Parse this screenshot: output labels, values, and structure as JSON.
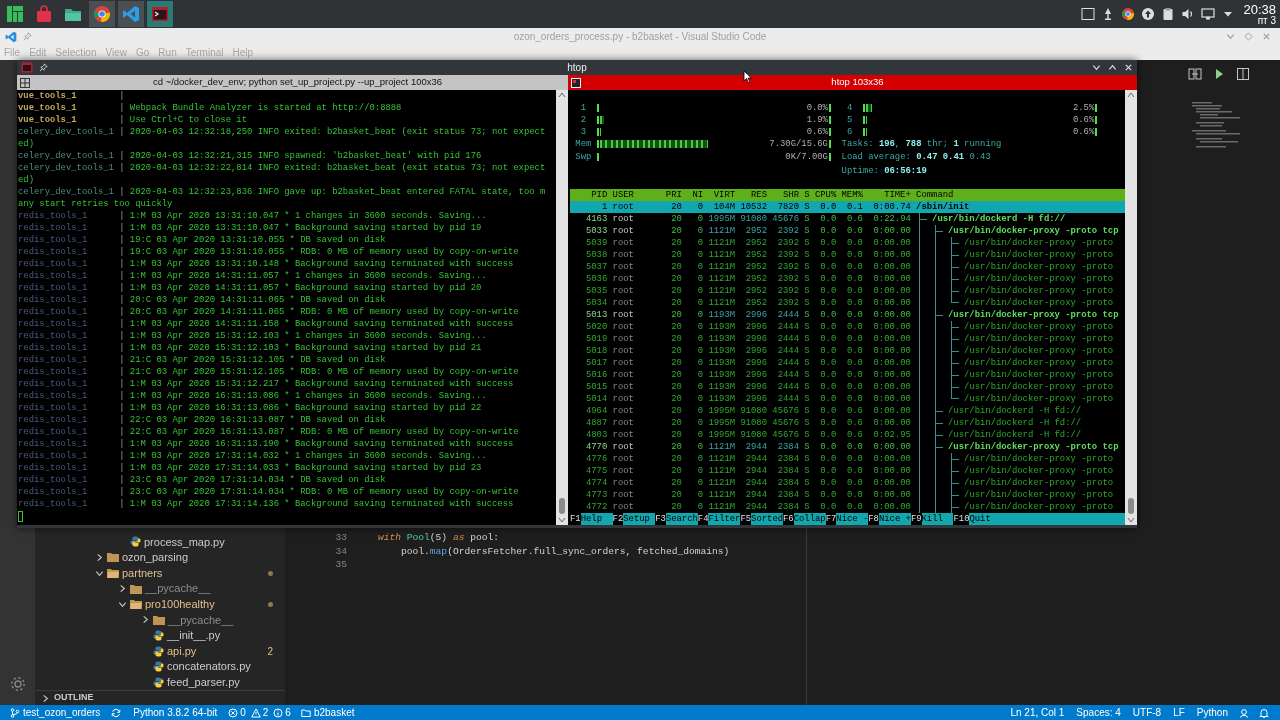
{
  "panel": {
    "tasks": [
      {
        "kind": "settings",
        "running": false,
        "selected": false
      },
      {
        "kind": "store",
        "running": false,
        "selected": false
      },
      {
        "kind": "files",
        "running": false,
        "selected": false
      },
      {
        "kind": "chrome",
        "running": true,
        "selected": false
      },
      {
        "kind": "vscode",
        "running": true,
        "selected": false
      },
      {
        "kind": "terminal",
        "running": true,
        "selected": true
      }
    ],
    "clock": {
      "time": "20:38",
      "day": "пт 3"
    }
  },
  "vscode": {
    "title": "ozon_orders_process.py - b2basket - Visual Studio Code",
    "menu": [
      "File",
      "Edit",
      "Selection",
      "View",
      "Go",
      "Run",
      "Terminal",
      "Help"
    ],
    "explorer": {
      "continued_files": [
        {
          "name": "process_map.py",
          "kind": "python",
          "modified": false,
          "ignored": false
        }
      ],
      "items": [
        {
          "name": "ozon_parsing",
          "kind": "folder",
          "modified": false,
          "ignored": false,
          "expanded": false
        },
        {
          "name": "partners",
          "kind": "folder",
          "modified": true,
          "ignored": false,
          "expanded": true,
          "children": [
            {
              "name": "__pycache__",
              "kind": "folder",
              "modified": false,
              "ignored": true,
              "expanded": false
            },
            {
              "name": "pro100healthy",
              "kind": "folder",
              "modified": true,
              "ignored": false,
              "expanded": true,
              "children": [
                {
                  "name": "__pycache__",
                  "kind": "folder",
                  "modified": false,
                  "ignored": true,
                  "expanded": false
                },
                {
                  "name": "__init__.py",
                  "kind": "python",
                  "modified": false,
                  "ignored": false
                },
                {
                  "name": "api.py",
                  "kind": "python",
                  "modified": true,
                  "ignored": false,
                  "problems": "2"
                },
                {
                  "name": "concatenators.py",
                  "kind": "python",
                  "modified": false,
                  "ignored": false
                },
                {
                  "name": "feed_parser.py",
                  "kind": "python",
                  "modified": false,
                  "ignored": false
                }
              ]
            }
          ]
        }
      ],
      "outline": {
        "label": "OUTLINE",
        "expanded": false
      }
    },
    "editor": {
      "lines": [
        {
          "number": "33",
          "tokens": [
            {
              "kind": "keyword",
              "text": "with"
            },
            {
              "kind": "class",
              "text": " Pool"
            },
            {
              "kind": "plain",
              "text": "(5) "
            },
            {
              "kind": "keyword",
              "text": "as"
            },
            {
              "kind": "plain",
              "text": " pool:"
            }
          ],
          "children": [
            {
              "number": "34",
              "tokens": [
                {
                  "kind": "plain",
                  "text": "pool."
                },
                {
                  "kind": "function",
                  "text": "map"
                },
                {
                  "kind": "plain",
                  "text": "(OrdersFetcher.full_sync_orders, fetched_domains)"
                }
              ]
            }
          ]
        },
        {
          "number": "35"
        }
      ]
    },
    "status_bar": {
      "left": [
        {
          "kind": "branch",
          "text": "test_ozon_orders"
        },
        {
          "kind": "sync"
        },
        {
          "kind": "interpreter",
          "text": "Python 3.8.2 64-bit"
        },
        {
          "kind": "problems",
          "errors": "0",
          "warnings": "2",
          "infos": "6"
        },
        {
          "kind": "folder",
          "text": "b2basket"
        }
      ],
      "right": [
        {
          "kind": "text",
          "text": "Ln 21, Col 1"
        },
        {
          "kind": "text",
          "text": "Spaces: 4"
        },
        {
          "kind": "text",
          "text": "UTF-8"
        },
        {
          "kind": "text",
          "text": "LF"
        },
        {
          "kind": "text",
          "text": "Python"
        },
        {
          "kind": "feedback"
        },
        {
          "kind": "bell"
        }
      ]
    }
  },
  "terminal": {
    "title": "htop",
    "left_pane": {
      "title": "cd ~/docker_dev_env; python set_up_project.py --up_project 100x36",
      "selected": false,
      "lines": [
        {
          "kind": "vue",
          "source": "vue_tools_1",
          "separator": "|"
        },
        {
          "kind": "vue",
          "source": "vue_tools_1",
          "separator": "|",
          "message": "Webpack Bundle Analyzer is started at http://0:8888"
        },
        {
          "kind": "vue",
          "source": "vue_tools_1",
          "separator": "|",
          "message": "Use Ctrl+C to close it"
        },
        {
          "kind": "celery",
          "source": "celery_dev_tools_1",
          "separator": "|",
          "message": "2020-04-03 12:32:18,250 INFO exited: b2basket_beat (exit status 73; not expect"
        },
        {
          "kind": "wrap",
          "message": "ed)"
        },
        {
          "kind": "celery",
          "source": "celery_dev_tools_1",
          "separator": "|",
          "message": "2020-04-03 12:32:21,315 INFO spawned: 'b2basket_beat' with pid 176"
        },
        {
          "kind": "celery",
          "source": "celery_dev_tools_1",
          "separator": "|",
          "message": "2020-04-03 12:32:22,814 INFO exited: b2basket_beat (exit status 73; not expect"
        },
        {
          "kind": "wrap",
          "message": "ed)"
        },
        {
          "kind": "celery",
          "source": "celery_dev_tools_1",
          "separator": "|",
          "message": "2020-04-03 12:32:23,836 INFO gave up: b2basket_beat entered FATAL state, too m"
        },
        {
          "kind": "wrap",
          "message": "any start retries too quickly"
        },
        {
          "kind": "redis",
          "source": "redis_tools_1",
          "separator": "|",
          "message": "1:M 03 Apr 2020 13:31:10.047 * 1 changes in 3600 seconds. Saving..."
        },
        {
          "kind": "redis",
          "source": "redis_tools_1",
          "separator": "|",
          "message": "1:M 03 Apr 2020 13:31:10.047 * Background saving started by pid 19"
        },
        {
          "kind": "redis",
          "source": "redis_tools_1",
          "separator": "|",
          "message": "19:C 03 Apr 2020 13:31:10.055 * DB saved on disk"
        },
        {
          "kind": "redis",
          "source": "redis_tools_1",
          "separator": "|",
          "message": "19:C 03 Apr 2020 13:31:10.055 * RDB: 0 MB of memory used by copy-on-write"
        },
        {
          "kind": "redis",
          "source": "redis_tools_1",
          "separator": "|",
          "message": "1:M 03 Apr 2020 13:31:10.148 * Background saving terminated with success"
        },
        {
          "kind": "redis",
          "source": "redis_tools_1",
          "separator": "|",
          "message": "1:M 03 Apr 2020 14:31:11.057 * 1 changes in 3600 seconds. Saving..."
        },
        {
          "kind": "redis",
          "source": "redis_tools_1",
          "separator": "|",
          "message": "1:M 03 Apr 2020 14:31:11.057 * Background saving started by pid 20"
        },
        {
          "kind": "redis",
          "source": "redis_tools_1",
          "separator": "|",
          "message": "20:C 03 Apr 2020 14:31:11.065 * DB saved on disk"
        },
        {
          "kind": "redis",
          "source": "redis_tools_1",
          "separator": "|",
          "message": "20:C 03 Apr 2020 14:31:11.065 * RDB: 0 MB of memory used by copy-on-write"
        },
        {
          "kind": "redis",
          "source": "redis_tools_1",
          "separator": "|",
          "message": "1:M 03 Apr 2020 14:31:11.158 * Background saving terminated with success"
        },
        {
          "kind": "redis",
          "source": "redis_tools_1",
          "separator": "|",
          "message": "1:M 03 Apr 2020 15:31:12.103 * 1 changes in 3600 seconds. Saving..."
        },
        {
          "kind": "redis",
          "source": "redis_tools_1",
          "separator": "|",
          "message": "1:M 03 Apr 2020 15:31:12.103 * Background saving started by pid 21"
        },
        {
          "kind": "redis",
          "source": "redis_tools_1",
          "separator": "|",
          "message": "21:C 03 Apr 2020 15:31:12.105 * DB saved on disk"
        },
        {
          "kind": "redis",
          "source": "redis_tools_1",
          "separator": "|",
          "message": "21:C 03 Apr 2020 15:31:12.105 * RDB: 0 MB of memory used by copy-on-write"
        },
        {
          "kind": "redis",
          "source": "redis_tools_1",
          "separator": "|",
          "message": "1:M 03 Apr 2020 15:31:12.217 * Background saving terminated with success"
        },
        {
          "kind": "redis",
          "source": "redis_tools_1",
          "separator": "|",
          "message": "1:M 03 Apr 2020 16:31:13.086 * 1 changes in 3600 seconds. Saving..."
        },
        {
          "kind": "redis",
          "source": "redis_tools_1",
          "separator": "|",
          "message": "1:M 03 Apr 2020 16:31:13.086 * Background saving started by pid 22"
        },
        {
          "kind": "redis",
          "source": "redis_tools_1",
          "separator": "|",
          "message": "22:C 03 Apr 2020 16:31:13.087 * DB saved on disk"
        },
        {
          "kind": "redis",
          "source": "redis_tools_1",
          "separator": "|",
          "message": "22:C 03 Apr 2020 16:31:13.087 * RDB: 0 MB of memory used by copy-on-write"
        },
        {
          "kind": "redis",
          "source": "redis_tools_1",
          "separator": "|",
          "message": "1:M 03 Apr 2020 16:31:13.190 * Background saving terminated with success"
        },
        {
          "kind": "redis",
          "source": "redis_tools_1",
          "separator": "|",
          "message": "1:M 03 Apr 2020 17:31:14.032 * 1 changes in 3600 seconds. Saving..."
        },
        {
          "kind": "redis",
          "source": "redis_tools_1",
          "separator": "|",
          "message": "1:M 03 Apr 2020 17:31:14.033 * Background saving started by pid 23"
        },
        {
          "kind": "redis",
          "source": "redis_tools_1",
          "separator": "|",
          "message": "23:C 03 Apr 2020 17:31:14.034 * DB saved on disk"
        },
        {
          "kind": "redis",
          "source": "redis_tools_1",
          "separator": "|",
          "message": "23:C 03 Apr 2020 17:31:14.034 * RDB: 0 MB of memory used by copy-on-write"
        },
        {
          "kind": "redis",
          "source": "redis_tools_1",
          "separator": "|",
          "message": "1:M 03 Apr 2020 17:31:14.136 * Background saving terminated with success"
        }
      ]
    },
    "right_pane": {
      "title": "htop 103x36",
      "selected": true,
      "htop": {
        "cpus": [
          {
            "label": "1",
            "level": 0,
            "reading": "0.0%"
          },
          {
            "label": "2",
            "level": 0.019,
            "reading": "1.9%"
          },
          {
            "label": "3",
            "level": 0.006,
            "reading": "0.6%"
          },
          {
            "label": "4",
            "level": 0.025,
            "reading": "2.5%"
          },
          {
            "label": "5",
            "level": 0.006,
            "reading": "0.6%"
          },
          {
            "label": "6",
            "level": 0.006,
            "reading": "0.6%"
          }
        ],
        "memory": {
          "label": "Mem",
          "level": 0.47,
          "reading": "7.30G/15.6G"
        },
        "swap": {
          "label": "Swp",
          "level": 0,
          "reading": "0K/7.00G"
        },
        "tasks": "Tasks: **196**, **788** thr; **1** running",
        "load": "Load average: **0.47** **0.41** 0.43",
        "uptime": "Uptime: **06:56:19**",
        "columns": [
          "PID",
          "USER",
          "PRI",
          "NI",
          "VIRT",
          "RES",
          "SHR",
          "S",
          "CPU%",
          "MEM%",
          "TIME+",
          "Command"
        ],
        "tree_continues": true,
        "processes": [
          {
            "pid": "1",
            "user": "root",
            "pri": "20",
            "ni": "0",
            "virt": "104M",
            "res": "10532",
            "shr": "7820",
            "s": "S",
            "cpu": "0.0",
            "mem": "0.1",
            "time": "0:00.74",
            "command": "/sbin/init",
            "kind": "process",
            "selected": true,
            "children": [
              {
                "pid": "4163",
                "user": "root",
                "pri": "20",
                "ni": "0",
                "virt": "1995M",
                "res": "91080",
                "shr": "45676",
                "s": "S",
                "cpu": "0.0",
                "mem": "0.6",
                "time": "0:22.94",
                "command": "/usr/bin/dockerd -H fd://",
                "kind": "process",
                "selected": false,
                "children": [
                  {
                    "pid": "5033",
                    "user": "root",
                    "pri": "20",
                    "ni": "0",
                    "virt": "1121M",
                    "res": "2952",
                    "shr": "2392",
                    "s": "S",
                    "cpu": "0.0",
                    "mem": "0.0",
                    "time": "0:00.00",
                    "command": "/usr/bin/docker-proxy -proto tcp",
                    "kind": "process",
                    "selected": false,
                    "children": [
                      {
                        "pid": "5039",
                        "user": "root",
                        "pri": "20",
                        "ni": "0",
                        "virt": "1121M",
                        "res": "2952",
                        "shr": "2392",
                        "s": "S",
                        "cpu": "0.0",
                        "mem": "0.0",
                        "time": "0:00.00",
                        "command": "/usr/bin/docker-proxy -proto",
                        "kind": "thread",
                        "selected": false
                      },
                      {
                        "pid": "5038",
                        "user": "root",
                        "pri": "20",
                        "ni": "0",
                        "virt": "1121M",
                        "res": "2952",
                        "shr": "2392",
                        "s": "S",
                        "cpu": "0.0",
                        "mem": "0.0",
                        "time": "0:00.00",
                        "command": "/usr/bin/docker-proxy -proto",
                        "kind": "thread",
                        "selected": false
                      },
                      {
                        "pid": "5037",
                        "user": "root",
                        "pri": "20",
                        "ni": "0",
                        "virt": "1121M",
                        "res": "2952",
                        "shr": "2392",
                        "s": "S",
                        "cpu": "0.0",
                        "mem": "0.0",
                        "time": "0:00.00",
                        "command": "/usr/bin/docker-proxy -proto",
                        "kind": "thread",
                        "selected": false
                      },
                      {
                        "pid": "5036",
                        "user": "root",
                        "pri": "20",
                        "ni": "0",
                        "virt": "1121M",
                        "res": "2952",
                        "shr": "2392",
                        "s": "S",
                        "cpu": "0.0",
                        "mem": "0.0",
                        "time": "0:00.00",
                        "command": "/usr/bin/docker-proxy -proto",
                        "kind": "thread",
                        "selected": false
                      },
                      {
                        "pid": "5035",
                        "user": "root",
                        "pri": "20",
                        "ni": "0",
                        "virt": "1121M",
                        "res": "2952",
                        "shr": "2392",
                        "s": "S",
                        "cpu": "0.0",
                        "mem": "0.0",
                        "time": "0:00.00",
                        "command": "/usr/bin/docker-proxy -proto",
                        "kind": "thread",
                        "selected": false
                      },
                      {
                        "pid": "5034",
                        "user": "root",
                        "pri": "20",
                        "ni": "0",
                        "virt": "1121M",
                        "res": "2952",
                        "shr": "2392",
                        "s": "S",
                        "cpu": "0.0",
                        "mem": "0.0",
                        "time": "0:00.00",
                        "command": "/usr/bin/docker-proxy -proto",
                        "kind": "thread",
                        "selected": false
                      }
                    ]
                  },
                  {
                    "pid": "5013",
                    "user": "root",
                    "pri": "20",
                    "ni": "0",
                    "virt": "1193M",
                    "res": "2996",
                    "shr": "2444",
                    "s": "S",
                    "cpu": "0.0",
                    "mem": "0.0",
                    "time": "0:00.00",
                    "command": "/usr/bin/docker-proxy -proto tcp",
                    "kind": "process",
                    "selected": false,
                    "children": [
                      {
                        "pid": "5020",
                        "user": "root",
                        "pri": "20",
                        "ni": "0",
                        "virt": "1193M",
                        "res": "2996",
                        "shr": "2444",
                        "s": "S",
                        "cpu": "0.0",
                        "mem": "0.0",
                        "time": "0:00.00",
                        "command": "/usr/bin/docker-proxy -proto",
                        "kind": "thread",
                        "selected": false
                      },
                      {
                        "pid": "5019",
                        "user": "root",
                        "pri": "20",
                        "ni": "0",
                        "virt": "1193M",
                        "res": "2996",
                        "shr": "2444",
                        "s": "S",
                        "cpu": "0.0",
                        "mem": "0.0",
                        "time": "0:00.00",
                        "command": "/usr/bin/docker-proxy -proto",
                        "kind": "thread",
                        "selected": false
                      },
                      {
                        "pid": "5018",
                        "user": "root",
                        "pri": "20",
                        "ni": "0",
                        "virt": "1193M",
                        "res": "2996",
                        "shr": "2444",
                        "s": "S",
                        "cpu": "0.0",
                        "mem": "0.0",
                        "time": "0:00.00",
                        "command": "/usr/bin/docker-proxy -proto",
                        "kind": "thread",
                        "selected": false
                      },
                      {
                        "pid": "5017",
                        "user": "root",
                        "pri": "20",
                        "ni": "0",
                        "virt": "1193M",
                        "res": "2996",
                        "shr": "2444",
                        "s": "S",
                        "cpu": "0.0",
                        "mem": "0.0",
                        "time": "0:00.00",
                        "command": "/usr/bin/docker-proxy -proto",
                        "kind": "thread",
                        "selected": false
                      },
                      {
                        "pid": "5016",
                        "user": "root",
                        "pri": "20",
                        "ni": "0",
                        "virt": "1193M",
                        "res": "2996",
                        "shr": "2444",
                        "s": "S",
                        "cpu": "0.0",
                        "mem": "0.0",
                        "time": "0:00.00",
                        "command": "/usr/bin/docker-proxy -proto",
                        "kind": "thread",
                        "selected": false
                      },
                      {
                        "pid": "5015",
                        "user": "root",
                        "pri": "20",
                        "ni": "0",
                        "virt": "1193M",
                        "res": "2996",
                        "shr": "2444",
                        "s": "S",
                        "cpu": "0.0",
                        "mem": "0.0",
                        "time": "0:00.00",
                        "command": "/usr/bin/docker-proxy -proto",
                        "kind": "thread",
                        "selected": false
                      },
                      {
                        "pid": "5014",
                        "user": "root",
                        "pri": "20",
                        "ni": "0",
                        "virt": "1193M",
                        "res": "2996",
                        "shr": "2444",
                        "s": "S",
                        "cpu": "0.0",
                        "mem": "0.0",
                        "time": "0:00.00",
                        "command": "/usr/bin/docker-proxy -proto",
                        "kind": "thread",
                        "selected": false
                      }
                    ]
                  },
                  {
                    "pid": "4964",
                    "user": "root",
                    "pri": "20",
                    "ni": "0",
                    "virt": "1995M",
                    "res": "91080",
                    "shr": "45676",
                    "s": "S",
                    "cpu": "0.0",
                    "mem": "0.6",
                    "time": "0:00.00",
                    "command": "/usr/bin/dockerd -H fd://",
                    "kind": "thread",
                    "selected": false
                  },
                  {
                    "pid": "4887",
                    "user": "root",
                    "pri": "20",
                    "ni": "0",
                    "virt": "1995M",
                    "res": "91080",
                    "shr": "45676",
                    "s": "S",
                    "cpu": "0.0",
                    "mem": "0.6",
                    "time": "0:00.00",
                    "command": "/usr/bin/dockerd -H fd://",
                    "kind": "thread",
                    "selected": false
                  },
                  {
                    "pid": "4803",
                    "user": "root",
                    "pri": "20",
                    "ni": "0",
                    "virt": "1995M",
                    "res": "91080",
                    "shr": "45676",
                    "s": "S",
                    "cpu": "0.0",
                    "mem": "0.6",
                    "time": "0:02.95",
                    "command": "/usr/bin/dockerd -H fd://",
                    "kind": "thread",
                    "selected": false
                  },
                  {
                    "pid": "4770",
                    "user": "root",
                    "pri": "20",
                    "ni": "0",
                    "virt": "1121M",
                    "res": "2944",
                    "shr": "2384",
                    "s": "S",
                    "cpu": "0.0",
                    "mem": "0.0",
                    "time": "0:00.00",
                    "command": "/usr/bin/docker-proxy -proto tcp",
                    "kind": "process",
                    "selected": false,
                    "children": [
                      {
                        "pid": "4776",
                        "user": "root",
                        "pri": "20",
                        "ni": "0",
                        "virt": "1121M",
                        "res": "2944",
                        "shr": "2384",
                        "s": "S",
                        "cpu": "0.0",
                        "mem": "0.0",
                        "time": "0:00.00",
                        "command": "/usr/bin/docker-proxy -proto",
                        "kind": "thread",
                        "selected": false
                      },
                      {
                        "pid": "4775",
                        "user": "root",
                        "pri": "20",
                        "ni": "0",
                        "virt": "1121M",
                        "res": "2944",
                        "shr": "2384",
                        "s": "S",
                        "cpu": "0.0",
                        "mem": "0.0",
                        "time": "0:00.00",
                        "command": "/usr/bin/docker-proxy -proto",
                        "kind": "thread",
                        "selected": false
                      },
                      {
                        "pid": "4774",
                        "user": "root",
                        "pri": "20",
                        "ni": "0",
                        "virt": "1121M",
                        "res": "2944",
                        "shr": "2384",
                        "s": "S",
                        "cpu": "0.0",
                        "mem": "0.0",
                        "time": "0:00.00",
                        "command": "/usr/bin/docker-proxy -proto",
                        "kind": "thread",
                        "selected": false
                      },
                      {
                        "pid": "4773",
                        "user": "root",
                        "pri": "20",
                        "ni": "0",
                        "virt": "1121M",
                        "res": "2944",
                        "shr": "2384",
                        "s": "S",
                        "cpu": "0.0",
                        "mem": "0.0",
                        "time": "0:00.00",
                        "command": "/usr/bin/docker-proxy -proto",
                        "kind": "thread",
                        "selected": false
                      },
                      {
                        "pid": "4772",
                        "user": "root",
                        "pri": "20",
                        "ni": "0",
                        "virt": "1121M",
                        "res": "2944",
                        "shr": "2384",
                        "s": "S",
                        "cpu": "0.0",
                        "mem": "0.0",
                        "time": "0:00.00",
                        "command": "/usr/bin/docker-proxy -proto",
                        "kind": "thread",
                        "selected": false
                      }
                    ]
                  }
                ]
              }
            ]
          }
        ],
        "keys": [
          {
            "key": "F1",
            "label": "Help"
          },
          {
            "key": "F2",
            "label": "Setup"
          },
          {
            "key": "F3",
            "label": "Search"
          },
          {
            "key": "F4",
            "label": "Filter"
          },
          {
            "key": "F5",
            "label": "Sorted"
          },
          {
            "key": "F6",
            "label": "Collap"
          },
          {
            "key": "F7",
            "label": "Nice -"
          },
          {
            "key": "F8",
            "label": "Nice +"
          },
          {
            "key": "F9",
            "label": "Kill"
          },
          {
            "key": "F10",
            "label": "Quit"
          }
        ]
      }
    }
  }
}
